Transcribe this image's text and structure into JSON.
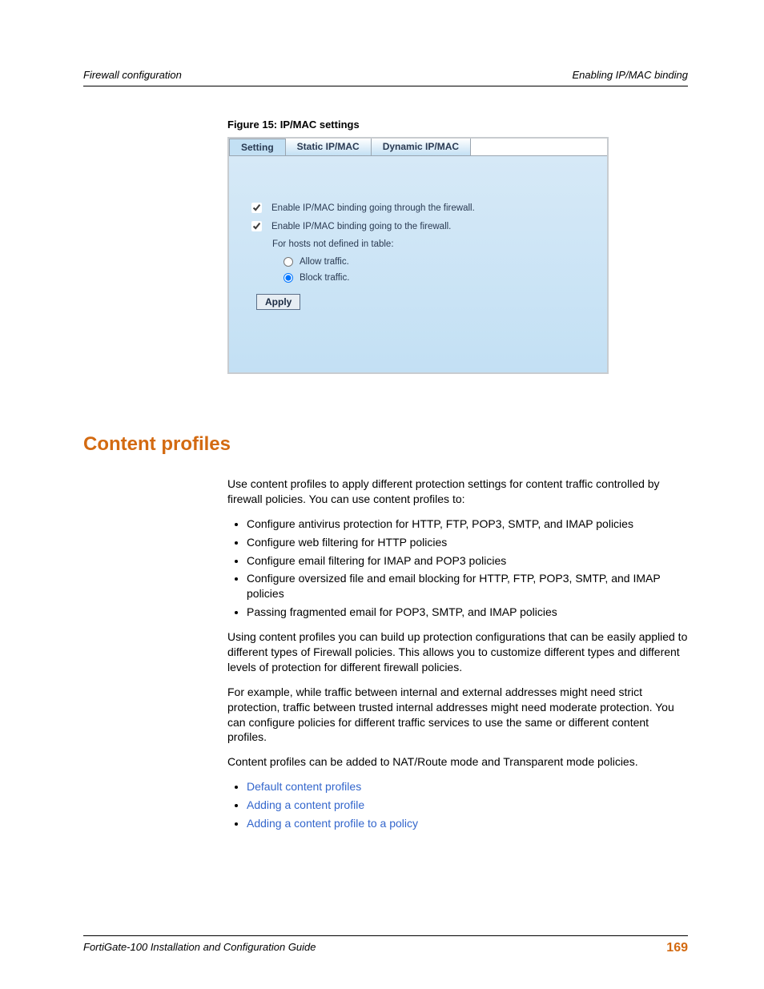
{
  "header": {
    "left": "Firewall configuration",
    "right": "Enabling IP/MAC binding"
  },
  "figure": {
    "caption": "Figure 15: IP/MAC settings",
    "tabs": {
      "setting": "Setting",
      "static": "Static IP/MAC",
      "dynamic": "Dynamic IP/MAC"
    },
    "checkbox1": "Enable IP/MAC binding going through the firewall.",
    "checkbox2": "Enable IP/MAC binding going to the firewall.",
    "sublabel": "For hosts not defined in table:",
    "radio_allow": "Allow traffic.",
    "radio_block": "Block traffic.",
    "apply": "Apply"
  },
  "section": {
    "heading": "Content profiles",
    "p1": "Use content profiles to apply different protection settings for content traffic controlled by firewall policies. You can use content profiles to:",
    "bullets1": [
      "Configure antivirus protection for HTTP, FTP, POP3, SMTP, and IMAP policies",
      "Configure web filtering for HTTP policies",
      "Configure email filtering for IMAP and POP3 policies",
      "Configure oversized file and email blocking for HTTP, FTP, POP3, SMTP, and IMAP policies",
      "Passing fragmented email for POP3, SMTP, and IMAP policies"
    ],
    "p2": "Using content profiles you can build up protection configurations that can be easily applied to different types of Firewall policies. This allows you to customize different types and different levels of protection for different firewall policies.",
    "p3": "For example, while traffic between internal and external addresses might need strict protection, traffic between trusted internal addresses might need moderate protection. You can configure policies for different traffic services to use the same or different content profiles.",
    "p4": "Content profiles can be added to NAT/Route mode and Transparent mode policies.",
    "links": [
      "Default content profiles",
      "Adding a content profile",
      "Adding a content profile to a policy"
    ]
  },
  "footer": {
    "guide": "FortiGate-100 Installation and Configuration Guide",
    "page": "169"
  }
}
